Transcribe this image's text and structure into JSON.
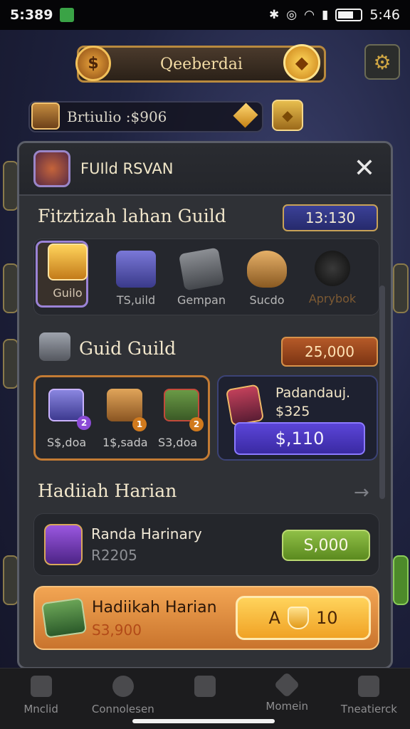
{
  "status_bar": {
    "time_left": "5:389",
    "time_right": "5:46"
  },
  "hud": {
    "banner_title": "Qeeberdai",
    "currency_text": "Brtiulio  :$906",
    "icons": [
      "coin-icon",
      "gold-gem-icon",
      "settings-gear-icon",
      "chest-icon"
    ]
  },
  "modal": {
    "title": "FUIld RSVAN",
    "close_label": "✕",
    "section1": {
      "title": "Fitztizah lahan Guild",
      "pill": "13:130",
      "items": [
        {
          "label": "Guilo",
          "icon": "gold-chest-icon"
        },
        {
          "label": "TS,uild",
          "icon": "purple-chest-icon"
        },
        {
          "label": "Gempan",
          "icon": "gear-box-icon"
        },
        {
          "label": "Sucdo",
          "icon": "shield-icon"
        },
        {
          "label": "Aprybok",
          "icon": "black-orb-icon"
        }
      ]
    },
    "section2": {
      "title": "Guid Guild",
      "pill": "25,000",
      "chests": [
        {
          "label": "S$,doa",
          "badge": "2"
        },
        {
          "label": "1$,sada",
          "badge": "1"
        },
        {
          "label": "S3,doa",
          "badge": "2"
        }
      ],
      "promo": {
        "title": "Padandauj.",
        "price": "$325",
        "button": "$,110"
      }
    },
    "section3": {
      "title": "Hadiiah Harian",
      "arrow": "→",
      "rewards": [
        {
          "name": "Randa Harinary",
          "value": "R2205",
          "button": "S,000"
        },
        {
          "name": "Hadiikah Harian",
          "value": "S3,900",
          "button_left": "A",
          "button_right": "10"
        }
      ]
    }
  },
  "bottom_nav": [
    {
      "label": "Mnclid",
      "icon": "home-icon"
    },
    {
      "label": "Connolesen",
      "icon": "compass-icon"
    },
    {
      "label": "",
      "icon": "castle-icon"
    },
    {
      "label": "Momein",
      "icon": "sword-icon"
    },
    {
      "label": "Tneatierck",
      "icon": "chart-icon"
    }
  ],
  "colors": {
    "modal_bg": "#2f3136",
    "accent_gold": "#f0a225",
    "accent_purple": "#5b45d8",
    "accent_green": "#8fbf47",
    "pill_blue": "#3b4197",
    "pill_orange": "#b55a28"
  }
}
